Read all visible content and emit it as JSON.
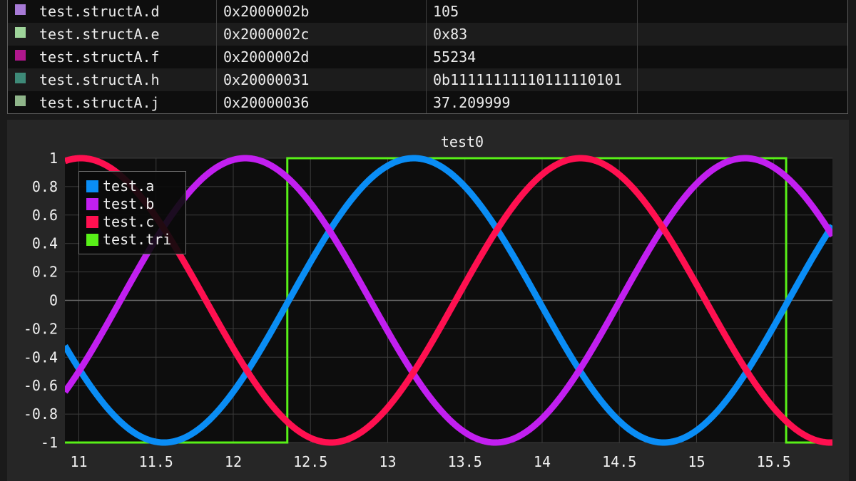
{
  "variables": [
    {
      "name": "test.structA.d",
      "address": "0x2000002b",
      "value": "105",
      "color": "#a77ad6"
    },
    {
      "name": "test.structA.e",
      "address": "0x2000002c",
      "value": "0x83",
      "color": "#9ed49a"
    },
    {
      "name": "test.structA.f",
      "address": "0x2000002d",
      "value": "55234",
      "color": "#b0178d"
    },
    {
      "name": "test.structA.h",
      "address": "0x20000031",
      "value": "0b11111111110111110101",
      "color": "#3e8a78"
    },
    {
      "name": "test.structA.j",
      "address": "0x20000036",
      "value": "37.209999",
      "color": "#8fb58a"
    }
  ],
  "plot": {
    "title": "test0",
    "legend": [
      {
        "name": "test.a",
        "color": "#0a8df5"
      },
      {
        "name": "test.b",
        "color": "#c21ff0"
      },
      {
        "name": "test.c",
        "color": "#ff1050"
      },
      {
        "name": "test.tri",
        "color": "#58f018"
      }
    ]
  },
  "chart_data": {
    "type": "line",
    "title": "test0",
    "xlim": [
      10.91,
      15.88
    ],
    "ylim": [
      -1,
      1
    ],
    "x_ticks": [
      "11",
      "11.5",
      "12",
      "12.5",
      "13",
      "13.5",
      "14",
      "14.5",
      "15",
      "15.5"
    ],
    "y_ticks": [
      "1",
      "0.8",
      "0.6",
      "0.4",
      "0.2",
      "0",
      "-0.2",
      "-0.4",
      "-0.6",
      "-0.8",
      "-1"
    ],
    "grid": true,
    "legend_position": "top-left",
    "series": [
      {
        "name": "test.a",
        "color": "#0a8df5",
        "function": "sine",
        "amplitude": 1,
        "period": 3.235,
        "zero_crossing_rising": 12.36
      },
      {
        "name": "test.b",
        "color": "#c21ff0",
        "function": "sine",
        "amplitude": 1,
        "period": 3.235,
        "zero_crossing_rising": 11.27
      },
      {
        "name": "test.c",
        "color": "#ff1050",
        "function": "sine",
        "amplitude": 1,
        "period": 3.235,
        "zero_crossing_rising": 13.44
      },
      {
        "name": "test.tri",
        "color": "#58f018",
        "function": "square",
        "x": [
          10.91,
          12.35,
          12.35,
          15.58,
          15.58,
          15.88
        ],
        "y": [
          -1,
          -1,
          1,
          1,
          -1,
          -1
        ]
      }
    ]
  }
}
